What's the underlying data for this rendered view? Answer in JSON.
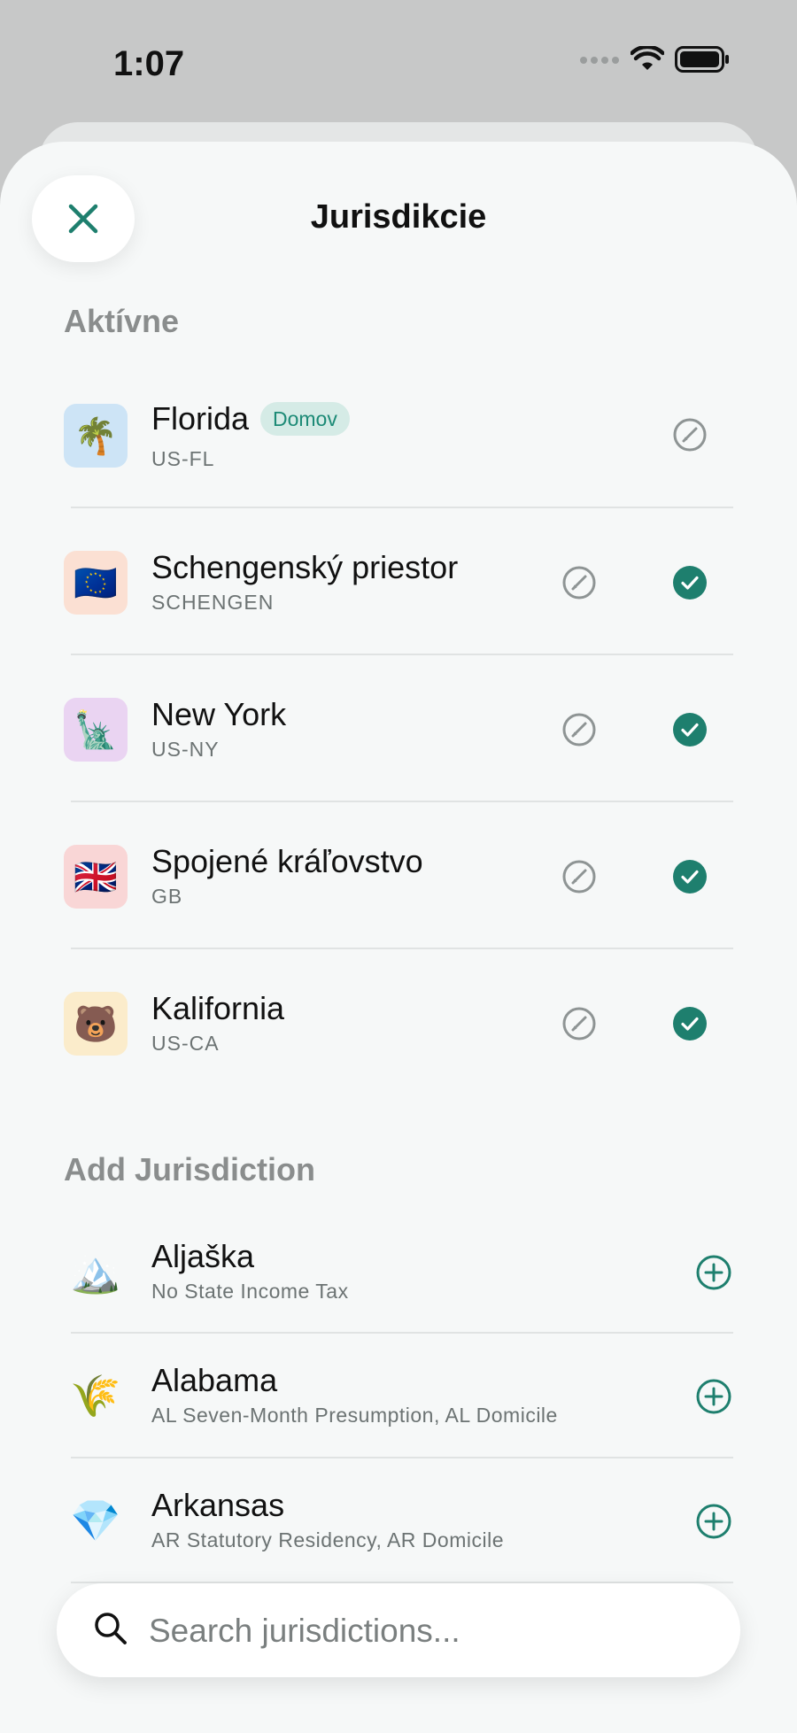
{
  "status_bar": {
    "time": "1:07"
  },
  "header": {
    "title": "Jurisdikcie"
  },
  "active_section": {
    "title": "Aktívne",
    "items": [
      {
        "name": "Florida",
        "code": "US-FL",
        "emoji": "🌴",
        "badge": "Domov",
        "tile_color": "#cde4f6"
      },
      {
        "name": "Schengenský priestor",
        "code": "SCHENGEN",
        "emoji": "🇪🇺",
        "tile_color": "#fbe0d3"
      },
      {
        "name": "New York",
        "code": "US-NY",
        "emoji": "🗽",
        "tile_color": "#ead4f2"
      },
      {
        "name": "Spojené kráľovstvo",
        "code": "GB",
        "emoji": "🇬🇧",
        "tile_color": "#f9d6d6"
      },
      {
        "name": "Kalifornia",
        "code": "US-CA",
        "emoji": "🐻",
        "tile_color": "#fbeccb"
      }
    ]
  },
  "add_section": {
    "title": "Add Jurisdiction",
    "items": [
      {
        "name": "Aljaška",
        "desc": "No State Income Tax",
        "emoji": "🏔️"
      },
      {
        "name": "Alabama",
        "desc": "AL Seven-Month Presumption, AL Domicile",
        "emoji": "🌾"
      },
      {
        "name": "Arkansas",
        "desc": "AR Statutory Residency, AR Domicile",
        "emoji": "💎"
      }
    ]
  },
  "search": {
    "placeholder": "Search jurisdictions..."
  },
  "colors": {
    "accent": "#1e7f6e",
    "muted_icon": "#8e9494"
  }
}
